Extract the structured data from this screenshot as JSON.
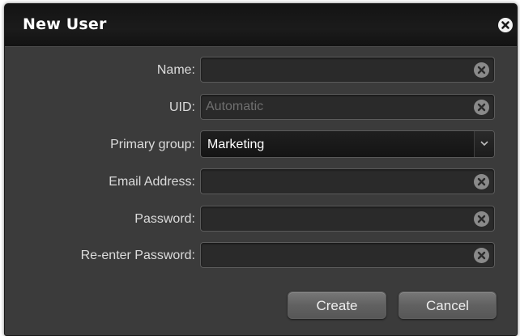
{
  "dialog": {
    "title": "New User",
    "close_icon": "close-circle-icon"
  },
  "form": {
    "name": {
      "label": "Name:",
      "value": "",
      "placeholder": ""
    },
    "uid": {
      "label": "UID:",
      "value": "",
      "placeholder": "Automatic"
    },
    "primary_group": {
      "label": "Primary group:",
      "selected": "Marketing"
    },
    "email": {
      "label": "Email Address:",
      "value": "",
      "placeholder": ""
    },
    "password": {
      "label": "Password:",
      "value": "",
      "placeholder": ""
    },
    "reenter_password": {
      "label": "Re-enter Password:",
      "value": "",
      "placeholder": ""
    },
    "clear_icon": "clear-circle-icon",
    "dropdown_icon": "chevron-down-icon"
  },
  "buttons": {
    "create": "Create",
    "cancel": "Cancel"
  },
  "colors": {
    "dialog_bg": "#3b3b3b",
    "titlebar_bg": "#161616",
    "field_bg": "#2a2a2a",
    "button_bg": "#666666"
  }
}
